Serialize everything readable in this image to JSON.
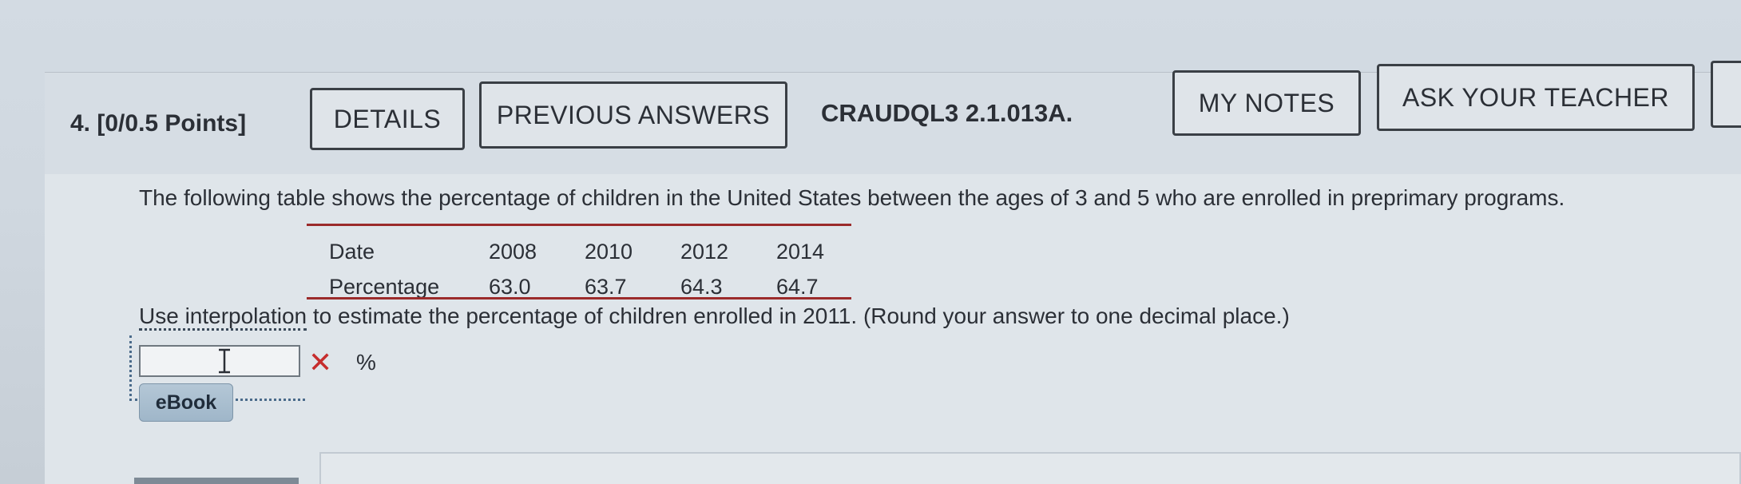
{
  "header": {
    "question_number": "4.",
    "points": "[0/0.5 Points]",
    "details_label": "DETAILS",
    "previous_answers_label": "PREVIOUS ANSWERS",
    "reference": "CRAUDQL3 2.1.013A.",
    "my_notes_label": "MY NOTES",
    "ask_teacher_label": "ASK YOUR TEACHER"
  },
  "question": {
    "text": "The following table shows the percentage of children in the United States between the ages of 3 and 5 who are enrolled in preprimary programs.",
    "table": {
      "row_labels": [
        "Date",
        "Percentage"
      ],
      "dates": [
        "2008",
        "2010",
        "2012",
        "2014"
      ],
      "percentages": [
        "63.0",
        "63.7",
        "64.3",
        "64.7"
      ]
    },
    "instruction_link": "Use interpolation",
    "instruction_rest": " to estimate the percentage of children enrolled in 2011. (Round your answer to one decimal place.)",
    "answer_value": "",
    "wrong_mark": "✕",
    "unit": "%",
    "ebook_label": "eBook"
  },
  "colors": {
    "table_rule": "#9b2b2b",
    "wrong": "#c62d2d",
    "ebook_bg": "#a9bdcf"
  }
}
